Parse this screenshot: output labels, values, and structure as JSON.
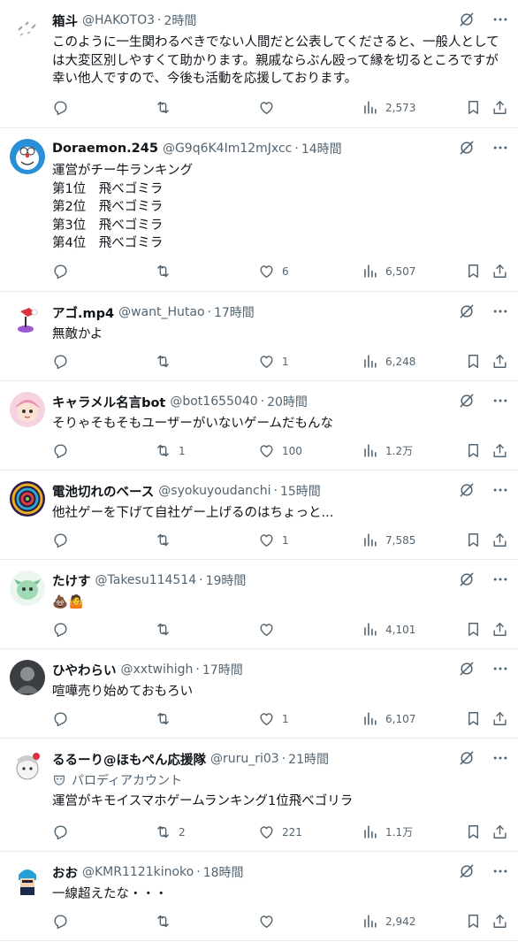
{
  "tweets": [
    {
      "name": "箱斗",
      "handle": "@HAKOTO3",
      "time": "2時間",
      "text": "このように一生関わるべきでない人間だと公表してくださると、一般人としては大変区別しやすくて助かります。親戚ならぶん殴って縁を切るところですが幸い他人ですので、今後も活動を応援しております。",
      "replies": "",
      "retweets": "",
      "likes": "",
      "views": "2,573",
      "parody": ""
    },
    {
      "name": "Doraemon.245",
      "handle": "@G9q6K4Im12mJxcc",
      "time": "14時間",
      "text": "運営がチー牛ランキング\n第1位　飛べゴミラ\n第2位　飛べゴミラ\n第3位　飛べゴミラ\n第4位　飛べゴミラ",
      "replies": "",
      "retweets": "",
      "likes": "6",
      "views": "6,507",
      "parody": ""
    },
    {
      "name": "アゴ.mp4",
      "handle": "@want_Hutao",
      "time": "17時間",
      "text": "無敵かよ",
      "replies": "",
      "retweets": "",
      "likes": "1",
      "views": "6,248",
      "parody": ""
    },
    {
      "name": "キャラメル名言bot",
      "handle": "@bot1655040",
      "time": "20時間",
      "text": "そりゃそもそもユーザーがいないゲームだもんな",
      "replies": "",
      "retweets": "1",
      "likes": "100",
      "views": "1.2万",
      "parody": ""
    },
    {
      "name": "電池切れのベース",
      "handle": "@syokuyoudanchi",
      "time": "15時間",
      "text": "他社ゲーを下げて自社ゲー上げるのはちょっと...",
      "replies": "",
      "retweets": "",
      "likes": "1",
      "views": "7,585",
      "parody": ""
    },
    {
      "name": "たけす",
      "handle": "@Takesu114514",
      "time": "19時間",
      "text": "💩🤷",
      "replies": "",
      "retweets": "",
      "likes": "",
      "views": "4,101",
      "parody": ""
    },
    {
      "name": "ひやわらい",
      "handle": "@xxtwihigh",
      "time": "17時間",
      "text": "喧嘩売り始めておもろい",
      "replies": "",
      "retweets": "",
      "likes": "1",
      "views": "6,107",
      "parody": ""
    },
    {
      "name": "るるーり@ほもぺん応援隊",
      "handle": "@ruru_ri03",
      "time": "21時間",
      "text": "運営がキモイスマホゲームランキング1位飛べゴリラ",
      "replies": "",
      "retweets": "2",
      "likes": "221",
      "views": "1.1万",
      "parody": "パロディアカウント"
    },
    {
      "name": "おお",
      "handle": "@KMR1121kinoko",
      "time": "18時間",
      "text": "一線超えたな・・・",
      "replies": "",
      "retweets": "",
      "likes": "",
      "views": "2,942",
      "parody": ""
    }
  ],
  "colors": {
    "text": "#0f1419",
    "muted": "#536471",
    "border": "#e6ecf0"
  },
  "icons": [
    "reply-icon",
    "retweet-icon",
    "like-icon",
    "views-icon",
    "bookmark-icon",
    "share-icon",
    "grok-icon",
    "more-icon",
    "parody-mask-icon"
  ]
}
